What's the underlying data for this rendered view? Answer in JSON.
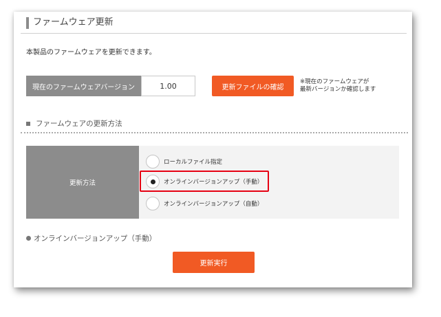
{
  "header": {
    "title": "ファームウェア更新"
  },
  "intro": "本製品のファームウェアを更新できます。",
  "version": {
    "label": "現在のファームウェアバージョン",
    "value": "1.00",
    "check_button": "更新ファイルの確認",
    "note_line1": "※現在のファームウェアが",
    "note_line2": "最新バージョンか確認します"
  },
  "update_method": {
    "heading": "ファームウェアの更新方法",
    "label": "更新方法",
    "options": [
      {
        "label": "ローカルファイル指定",
        "selected": false
      },
      {
        "label": "オンラインバージョンアップ（手動）",
        "selected": true
      },
      {
        "label": "オンラインバージョンアップ（自動）",
        "selected": false
      }
    ]
  },
  "online_manual": {
    "heading": "オンラインバージョンアップ（手動）",
    "execute_button": "更新実行"
  },
  "colors": {
    "accent": "#f15a24",
    "label_bg": "#8c8c8c",
    "highlight": "#e60012"
  }
}
